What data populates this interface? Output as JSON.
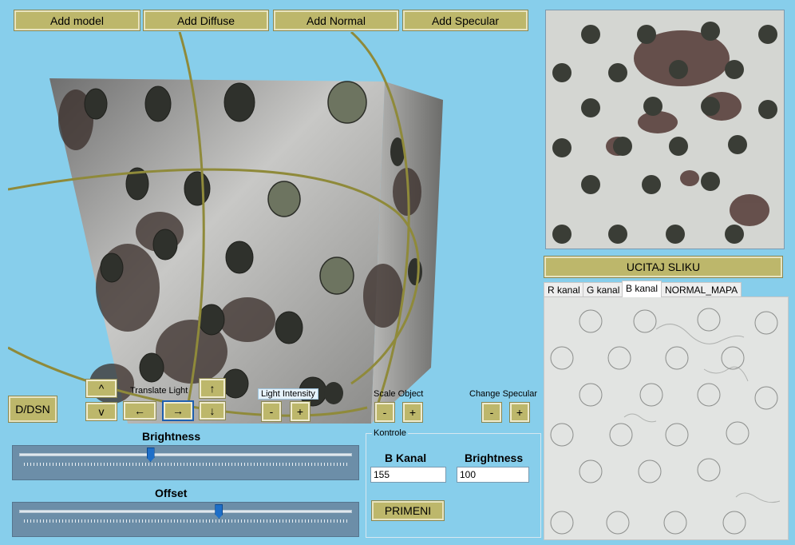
{
  "toolbar": {
    "add_model": "Add model",
    "add_diffuse": "Add Diffuse",
    "add_normal": "Add Normal",
    "add_specular": "Add Specular"
  },
  "controls": {
    "dsn_button": "D/DSN",
    "up_button": "^",
    "down_button": "v",
    "translate_light_label": "Translate Light",
    "arrow_up": "↑",
    "arrow_down": "↓",
    "arrow_left": "←",
    "arrow_right": "→",
    "light_intensity_label": "Light Intensity",
    "minus": "-",
    "plus": "+",
    "scale_object_label": "Scale Object",
    "change_specular_label": "Change Specular"
  },
  "sliders": {
    "brightness_label": "Brightness",
    "brightness_value": 0.39,
    "offset_label": "Offset",
    "offset_value": 0.6
  },
  "kontrole": {
    "title": "Kontrole",
    "b_kanal_label": "B Kanal",
    "b_kanal_value": "155",
    "brightness_label": "Brightness",
    "brightness_value": "100",
    "apply_button": "PRIMENI"
  },
  "right_panel": {
    "load_button": "UCITAJ SLIKU",
    "tabs": [
      "R kanal",
      "G kanal",
      "B kanal",
      "NORMAL_MAPA"
    ],
    "selected_tab": "B kanal"
  },
  "colors": {
    "background": "#87ceeb",
    "button": "#bdb76b",
    "slider_panel": "#6c8ea8",
    "slider_thumb": "#1e6fc8",
    "light_path": "#8f8a3a"
  }
}
